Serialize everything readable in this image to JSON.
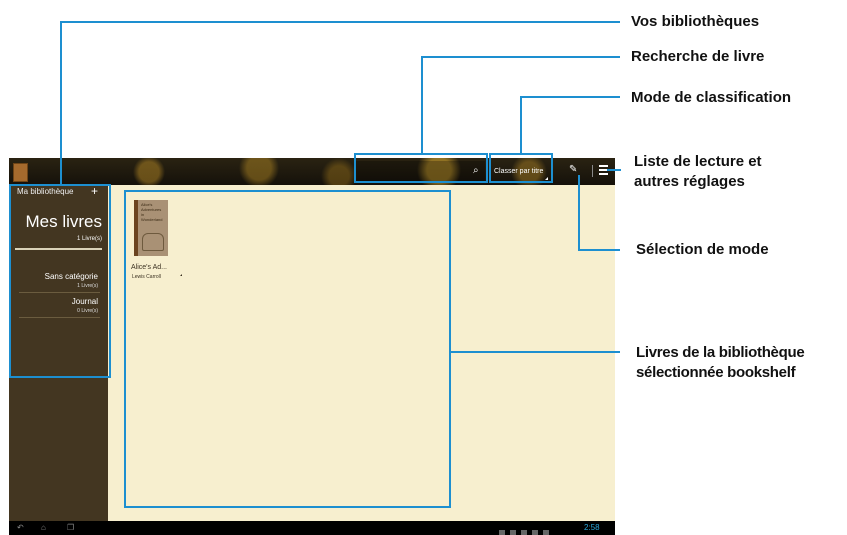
{
  "topbar": {
    "sort_label": "Classer par titre"
  },
  "sidebar": {
    "library_label": "Ma bibliothèque",
    "add_icon": "+",
    "current_shelf": {
      "title": "Mes livres",
      "count": "1 Livre(s)"
    },
    "shelves": [
      {
        "name": "Sans catégorie",
        "count": "1 Livre(s)"
      },
      {
        "name": "Journal",
        "count": "0 Livre(s)"
      }
    ]
  },
  "book": {
    "cover_text": "Alice's Adventures in Wonderland",
    "title": "Alice's Ad...",
    "author": "Lewis Carroll"
  },
  "statusbar": {
    "clock": "2:58"
  },
  "icons": {
    "search": "search-icon",
    "mode": "pencil-icon",
    "menu": "menu-icon",
    "back": "back-icon",
    "home": "home-icon",
    "recent": "recent-apps-icon"
  },
  "callouts": {
    "libraries": "Vos bibliothèques",
    "search": "Recherche de livre",
    "sort_mode": "Mode de classification",
    "reading_list_1": "Liste de lecture et",
    "reading_list_2": "autres réglages",
    "mode_select": "Sélection de mode",
    "books_1": "Livres de la bibliothèque",
    "books_2": "sélectionnée bookshelf"
  },
  "colors": {
    "callout_line": "#1d8fd0",
    "content_bg": "#f7efcf",
    "sidebar_bg": "#433621",
    "clock": "#2aa6d8"
  }
}
